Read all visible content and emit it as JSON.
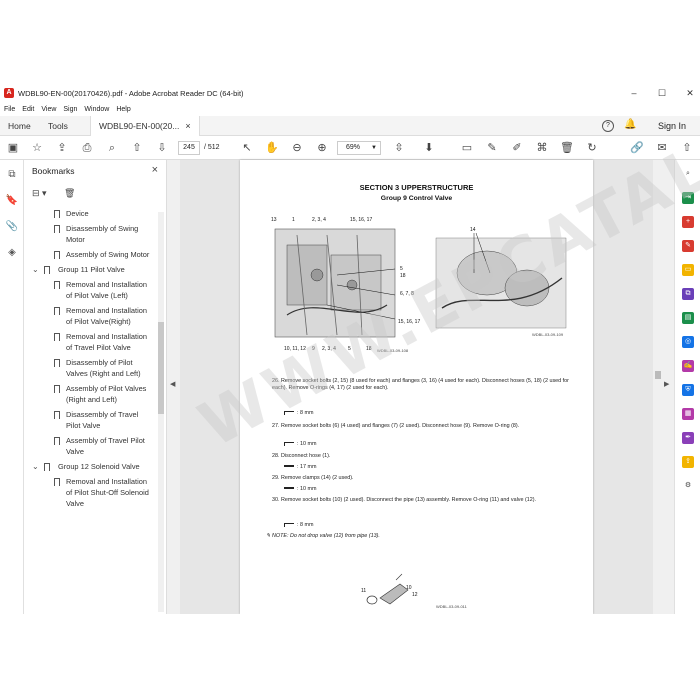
{
  "window": {
    "title": "WDBL90-EN-00(20170426).pdf - Adobe Acrobat Reader DC (64-bit)",
    "minimize": "–",
    "maximize": "☐",
    "close": "✕"
  },
  "menu": [
    "File",
    "Edit",
    "View",
    "Sign",
    "Window",
    "Help"
  ],
  "tabs": {
    "home": "Home",
    "tools": "Tools",
    "document": "WDBL90-EN-00(20...",
    "close": "×",
    "sign_in": "Sign In"
  },
  "toolbar": {
    "current_page": "245",
    "total_pages": "/ 512",
    "zoom": "69%"
  },
  "bookmarks": {
    "title": "Bookmarks",
    "close": "×",
    "options": "⊟ ▾",
    "items": [
      {
        "level": 2,
        "label": "Device",
        "cut": true
      },
      {
        "level": 2,
        "label": "Disassembly of Swing Motor"
      },
      {
        "level": 2,
        "label": "Assembly of Swing Motor"
      },
      {
        "level": 1,
        "label": "Group 11 Pilot Valve",
        "chevron": "⌄"
      },
      {
        "level": 2,
        "label": "Removal and Installation of Pilot Valve (Left)"
      },
      {
        "level": 2,
        "label": "Removal and Installation of Pilot Valve(Right)"
      },
      {
        "level": 2,
        "label": "Removal and Installation of Travel Pilot Valve"
      },
      {
        "level": 2,
        "label": "Disassembly of Pilot Valves (Right and Left)"
      },
      {
        "level": 2,
        "label": "Assembly of Pilot Valves (Right and Left)"
      },
      {
        "level": 2,
        "label": "Disassembly of Travel Pilot Valve"
      },
      {
        "level": 2,
        "label": "Assembly of Travel Pilot Valve"
      },
      {
        "level": 1,
        "label": "Group 12 Solenoid Valve",
        "chevron": "⌄"
      },
      {
        "level": 2,
        "label": "Removal and Installation of Pilot Shut-Off Solenoid Valve"
      }
    ]
  },
  "page": {
    "section": "SECTION 3 UPPERSTRUCTURE",
    "group": "Group 9 Control Valve",
    "labels_fig1": [
      "13",
      "1",
      "2, 3, 4",
      "15, 16, 17",
      "5",
      "18",
      "6, 7, 8",
      "15, 16, 17",
      "10, 11, 12",
      "9",
      "2, 3, 4",
      "5",
      "18"
    ],
    "fig1_code": "WDBL-03-09-108",
    "labels_fig2": [
      "14"
    ],
    "fig2_code": "WDBL-03-09-109",
    "steps": [
      "26. Remove socket bolts (2, 15) (8 used for each) and flanges (3, 16) (4 used for each). Disconnect hoses (5, 18) (2 used for each). Remove O-rings (4, 17) (2 used for each).",
      "27. Remove socket bolts (6) (4 used) and flanges (7) (2 used). Disconnect hose (9). Remove O-ring (8).",
      "28. Disconnect hose (1).",
      "29. Remove clamps (14) (2 used).",
      "30. Remove socket bolts (10) (2 used). Disconnect the pipe (13) assembly. Remove O-ring (11) and valve (12)."
    ],
    "tools": [
      ": 8 mm",
      ": 10 mm",
      ": 17 mm",
      ": 10 mm",
      ": 8 mm"
    ],
    "note": "NOTE: Do not drop valve (12) from pipe (13).",
    "labels_fig3": [
      "11",
      "12",
      "10"
    ],
    "fig3_code": "WDBL-03-09-011"
  },
  "watermark": "WWW.EPCATALOGS.COM",
  "colors": {
    "accent": "#1473e6",
    "acrobat_red": "#d7261e"
  }
}
